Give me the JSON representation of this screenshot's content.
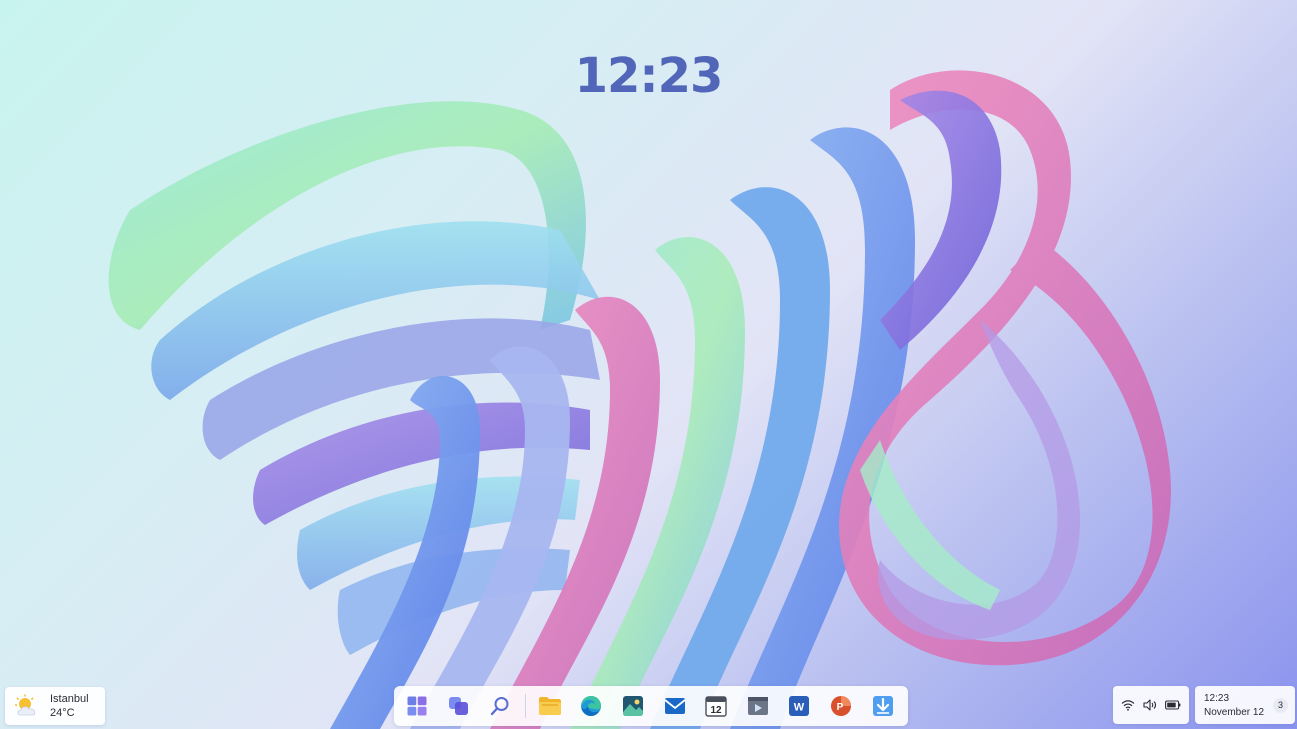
{
  "desktop": {
    "clock": "12:23"
  },
  "weather": {
    "icon": "partly-cloudy-icon",
    "city": "Istanbul",
    "temperature": "24°C"
  },
  "taskbar": {
    "apps": [
      {
        "name": "start",
        "icon": "windows-logo-icon"
      },
      {
        "name": "task-view",
        "icon": "task-view-icon"
      },
      {
        "name": "search",
        "icon": "search-icon"
      },
      {
        "name": "file-explorer",
        "icon": "folder-icon"
      },
      {
        "name": "edge",
        "icon": "edge-browser-icon"
      },
      {
        "name": "photos",
        "icon": "photos-icon"
      },
      {
        "name": "mail",
        "icon": "mail-icon"
      },
      {
        "name": "calendar",
        "icon": "calendar-icon",
        "label": "12"
      },
      {
        "name": "media-player",
        "icon": "media-player-icon"
      },
      {
        "name": "word",
        "icon": "word-icon",
        "label": "W"
      },
      {
        "name": "powerpoint",
        "icon": "powerpoint-icon",
        "label": "P"
      },
      {
        "name": "downloads",
        "icon": "download-icon"
      }
    ]
  },
  "tray": {
    "icons": [
      "wifi-icon",
      "volume-icon",
      "battery-icon"
    ]
  },
  "datetime": {
    "time": "12:23",
    "date": "November 12",
    "notification_count": "3"
  },
  "colors": {
    "clock": "#5166b8",
    "accent_blue": "#2d7bd8",
    "word_blue": "#2b5eb8",
    "powerpoint_orange": "#d8502c",
    "folder_yellow": "#f0b42a"
  }
}
